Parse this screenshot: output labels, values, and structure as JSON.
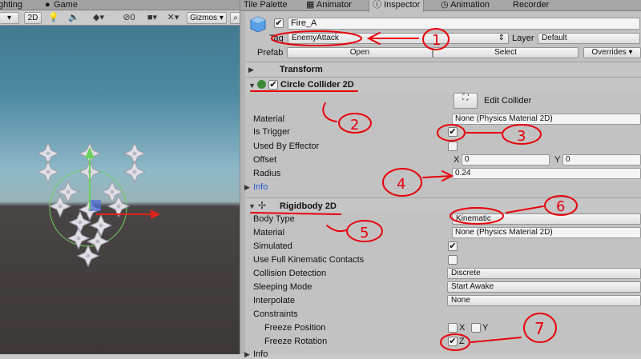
{
  "scene": {
    "tabs": [
      "ghting",
      "Game"
    ],
    "toolbar": {
      "mode_2d": "2D",
      "layers_count": "0",
      "gizmos_label": "Gizmos"
    }
  },
  "panel_tabs": [
    "Tile Palette",
    "Animator",
    "Inspector",
    "Animation",
    "Recorder"
  ],
  "object": {
    "name": "Fire_A",
    "tag_label": "Tag",
    "tag_value": "EnemyAttack",
    "layer_label": "Layer",
    "layer_value": "Default",
    "prefab_label": "Prefab",
    "open_label": "Open",
    "select_label": "Select",
    "overrides_label": "Overrides"
  },
  "transform": {
    "title": "Transform"
  },
  "circle_collider": {
    "title": "Circle Collider 2D",
    "edit_collider_label": "Edit Collider",
    "material_label": "Material",
    "material_value": "None (Physics Material 2D)",
    "is_trigger_label": "Is Trigger",
    "is_trigger": true,
    "used_by_effector_label": "Used By Effector",
    "used_by_effector": false,
    "offset_label": "Offset",
    "offset_x_label": "X",
    "offset_x": "0",
    "offset_y_label": "Y",
    "offset_y": "0",
    "radius_label": "Radius",
    "radius_value": "0.24",
    "info_label": "Info"
  },
  "rigidbody": {
    "title": "Rigidbody 2D",
    "body_type_label": "Body Type",
    "body_type_value": "Kinematic",
    "material_label": "Material",
    "material_value": "None (Physics Material 2D)",
    "simulated_label": "Simulated",
    "simulated": true,
    "full_kinematic_label": "Use Full Kinematic Contacts",
    "full_kinematic": false,
    "collision_detection_label": "Collision Detection",
    "collision_detection_value": "Discrete",
    "sleeping_mode_label": "Sleeping Mode",
    "sleeping_mode_value": "Start Awake",
    "interpolate_label": "Interpolate",
    "interpolate_value": "None",
    "constraints_label": "Constraints",
    "freeze_position_label": "Freeze Position",
    "freeze_position_x_label": "X",
    "freeze_position_y_label": "Y",
    "freeze_rotation_label": "Freeze Rotation",
    "freeze_rotation_z_label": "Z",
    "freeze_rotation_z": true,
    "info_label": "Info"
  },
  "annotations": [
    "1",
    "2",
    "3",
    "4",
    "5",
    "6",
    "7"
  ],
  "colors": {
    "annotation_red": "#e8000a",
    "gizmo_green": "#6bd15e",
    "gizmo_red": "#e0241c",
    "info_blue": "#2c5bd3"
  }
}
